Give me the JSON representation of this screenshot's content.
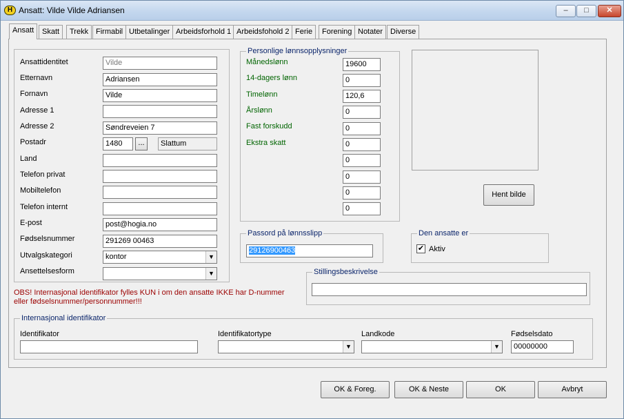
{
  "window": {
    "title": "Ansatt: Vilde Vilde Adriansen",
    "app_icon_letter": "H",
    "minimize_icon": "–",
    "maximize_icon": "□",
    "close_icon": "✕"
  },
  "tabs": [
    {
      "label": "Ansatt",
      "active": true
    },
    {
      "label": "Skatt"
    },
    {
      "label": "Trekk"
    },
    {
      "label": "Firmabil"
    },
    {
      "label": "Utbetalinger"
    },
    {
      "label": "Arbeidsforhold 1"
    },
    {
      "label": "Arbeidsfohold 2"
    },
    {
      "label": "Ferie"
    },
    {
      "label": "Forening"
    },
    {
      "label": "Notater"
    },
    {
      "label": "Diverse"
    }
  ],
  "personal": {
    "ansattidentitet": {
      "label": "Ansattidentitet",
      "value": "Vilde"
    },
    "etternavn": {
      "label": "Etternavn",
      "value": "Adriansen"
    },
    "fornavn": {
      "label": "Fornavn",
      "value": "Vilde"
    },
    "adresse1": {
      "label": "Adresse 1",
      "value": ""
    },
    "adresse2": {
      "label": "Adresse 2",
      "value": "Søndreveien 7"
    },
    "postadr": {
      "label": "Postadr",
      "value": "1480",
      "button": "...",
      "city": "Slattum"
    },
    "land": {
      "label": "Land",
      "value": ""
    },
    "telefon_privat": {
      "label": "Telefon privat",
      "value": ""
    },
    "mobiltelefon": {
      "label": "Mobiltelefon",
      "value": ""
    },
    "telefon_internt": {
      "label": "Telefon internt",
      "value": ""
    },
    "epost": {
      "label": "E-post",
      "value": "post@hogia.no"
    },
    "fodselsnummer": {
      "label": "Fødselsnummer",
      "value": "291269 00463"
    },
    "utvalgskategori": {
      "label": "Utvalgskategori",
      "value": "kontor"
    },
    "ansettelsesform": {
      "label": "Ansettelsesform",
      "value": ""
    }
  },
  "salary": {
    "title": "Personlige lønnsopplysninger",
    "fields": [
      {
        "label": "Månedslønn",
        "value": "19600"
      },
      {
        "label": "14-dagers lønn",
        "value": "0"
      },
      {
        "label": "Timelønn",
        "value": "120,6"
      },
      {
        "label": "Årslønn",
        "value": "0"
      },
      {
        "label": "Fast forskudd",
        "value": "0"
      },
      {
        "label": "Ekstra skatt",
        "value": "0"
      },
      {
        "label": "",
        "value": "0"
      },
      {
        "label": "",
        "value": "0"
      },
      {
        "label": "",
        "value": "0"
      },
      {
        "label": "",
        "value": "0"
      }
    ]
  },
  "photo": {
    "button": "Hent bilde"
  },
  "password": {
    "title": "Passord på lønnsslipp",
    "value": "29126900463"
  },
  "employee_status": {
    "title": "Den ansatte er",
    "checkbox_label": "Aktiv",
    "checked_glyph": "✔"
  },
  "job_description": {
    "title": "Stillingsbeskrivelse",
    "value": ""
  },
  "warning": "OBS! Internasjonal identifikator fylles KUN i om den ansatte IKKE har D-nummer eller fødselsnummer/personnummer!!!",
  "international": {
    "title": "Internasjonal identifikator",
    "identifikator": {
      "label": "Identifikator",
      "value": ""
    },
    "identifikatortype": {
      "label": "Identifikatortype",
      "value": ""
    },
    "landkode": {
      "label": "Landkode",
      "value": ""
    },
    "fodselsdato": {
      "label": "Fødselsdato",
      "value": "00000000"
    }
  },
  "combo_arrow": "▼",
  "buttons": {
    "ok_foreg": "OK & Foreg.",
    "ok_neste": "OK & Neste",
    "ok": "OK",
    "avbryt": "Avbryt"
  }
}
